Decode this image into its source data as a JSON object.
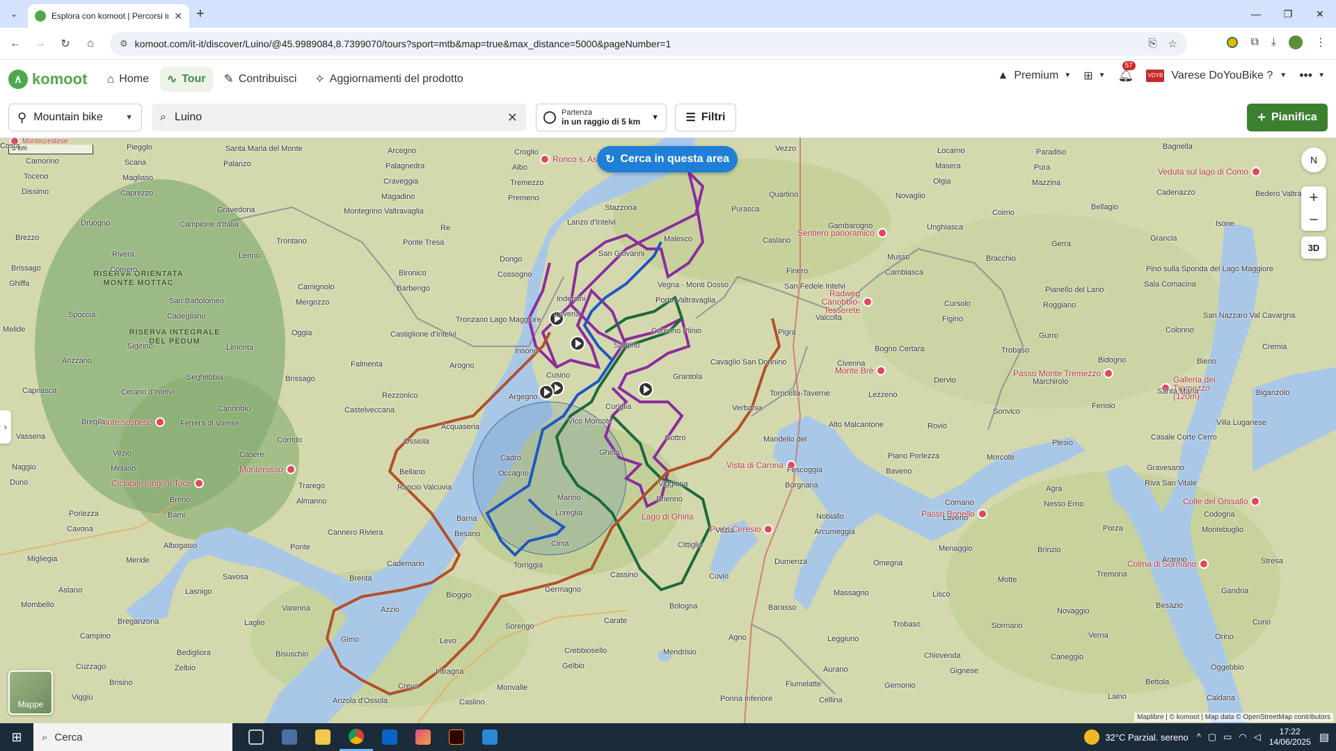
{
  "browser": {
    "tab_title": "Esplora con komoot | Percorsi in bici",
    "url": "komoot.com/it-it/discover/Luino/@45.9989084,8.7399070/tours?sport=mtb&map=true&max_distance=5000&pageNumber=1"
  },
  "header": {
    "logo": "komoot",
    "nav": [
      {
        "label": "Home",
        "icon": "home-icon"
      },
      {
        "label": "Tour",
        "icon": "tour-icon"
      },
      {
        "label": "Contribuisci",
        "icon": "contribute-icon"
      },
      {
        "label": "Aggiornamenti del prodotto",
        "icon": "updates-icon"
      }
    ],
    "premium": "Premium",
    "notifications_count": "57",
    "user_name": "Varese DoYouBike ?"
  },
  "filters": {
    "sport": "Mountain bike",
    "search_value": "Luino",
    "start_label": "Partenza",
    "start_value": "in un raggio di 5 km",
    "filters_label": "Filtri",
    "plan_label": "Pianifica"
  },
  "map": {
    "scale_label": "5 km",
    "search_area_label": "Cerca in questa area",
    "btn_3d": "3D",
    "compass_label": "N",
    "maps_label": "Mappe",
    "attribution": "Maplibre | © komoot | Map data © OpenStreetMap contributors",
    "regions": [
      {
        "text": "RISERVA ORIENTATA\nMONTE MOTTAC"
      },
      {
        "text": "RISERVA INTEGRALE\nDEL PEDUM"
      }
    ],
    "pois": [
      "Ronco s. Ascona",
      "Veduta sul lago di Como",
      "Sentiero panoramico",
      "Radweg Canobbio-Tesserete",
      "Monte Brè",
      "Passo Monte Tremezzo",
      "Galleria del Tremezzo (120m)",
      "Ponte sospeso",
      "Monterosso",
      "Ciclabile lungo il Toce",
      "Vista di Carona",
      "Lago di Ghirla",
      "Porto Ceresio",
      "Passo Bonello",
      "Colle del Ghisallo",
      "Colma di Sormano",
      "Montecrestese"
    ],
    "places": [
      "Costa",
      "Arcegno",
      "Locarno",
      "Camorino",
      "Palagnedra",
      "Masera",
      "Toceno",
      "Craveggia",
      "Olgia",
      "Dissimo",
      "Magadino",
      "Quartino",
      "Cadenazzo",
      "Gravedona",
      "Stazzona",
      "Coimo",
      "Druogno",
      "Re",
      "Gambarogno",
      "Isone",
      "Trontano",
      "Malesco",
      "Gerra",
      "Rivera",
      "Dongo",
      "Musso",
      "Brissago",
      "Bironico",
      "Finero",
      "Pino sulla Sponda del Lago Maggiore",
      "Camignolo",
      "Vegna - Monti Dosso",
      "Pianello del Lario",
      "San Bartolomeo",
      "Indemini",
      "Cursolo",
      "Spoccia",
      "Tronzano Lago Maggiore",
      "Valcolla",
      "San Nazzaro Val Cavargna",
      "Oggia",
      "Corenno Plinio",
      "Gurro",
      "Sigirino",
      "Insone",
      "Bogno Certara",
      "Cremia",
      "Falmenta",
      "Cavaglio San Donnino",
      "Bidogno",
      "Seghebbia",
      "Cusino",
      "Dervio",
      "Capriasca",
      "Rezzonico",
      "Torricella-Taverne",
      "Santa Maria",
      "Cannobio",
      "Curiglia",
      "Sonvico",
      "Bregila",
      "Acquaseria",
      "Alto Malcantone",
      "Villa Luganese",
      "Corrido",
      "Gottro",
      "Plesio",
      "Vezio",
      "Cadro",
      "Piano Porlezza",
      "Naggio",
      "Bellano",
      "Fescoggia",
      "Gravesano",
      "Trarego",
      "Viggiona",
      "Agra",
      "Breno",
      "Manno",
      "Comano",
      "Porlezza",
      "Barna",
      "Nobiallo",
      "Codogna",
      "Cannero Riviera",
      "Vezia",
      "Porza",
      "Albogasio",
      "Cima",
      "Menaggio",
      "Migliegia",
      "Cademario",
      "Dumenza",
      "Aranno",
      "Savosa",
      "Cassino",
      "Motte",
      "Astano",
      "Bioggio",
      "Massagno",
      "Gandria",
      "Varenna",
      "Bologna",
      "Novaggio",
      "Breganzona",
      "Sorengo",
      "Trobaso",
      "Curio",
      "Gimo",
      "Agno",
      "Verna",
      "Bedigliora",
      "Crebbiosello",
      "Chiovenda",
      "Cuzzago",
      "Intragna",
      "Aurano",
      "Oggebbio",
      "Creva",
      "Fiumelatte",
      "Bettola",
      "Anzola d'Ossola",
      "Ponna Inferiore",
      "Laino",
      "Piegglo",
      "Croglio",
      "Paradiso",
      "Scaria",
      "Albo",
      "Pura",
      "Magliaso",
      "Tremezzo",
      "Mazzina",
      "Caprezzo",
      "Premeno",
      "Novaglio",
      "Bedero Valtravaglia",
      "Montegrino Valtravaglia",
      "Purasca",
      "Bellagio",
      "Campione d'Italia",
      "Lanzo d'Intelvi",
      "Unghiasca",
      "Brezzo",
      "Ponte Tresa",
      "Caslano",
      "Grancia",
      "Lenno",
      "San Giovanni",
      "Bracchio",
      "Comero",
      "Cossogno",
      "Cambiasca",
      "Ghiffa",
      "Barbengo",
      "San Fedele Intelvi",
      "Sala Comacina",
      "Mergozzo",
      "Porto Valtravaglia",
      "Roggiano",
      "Cadegliano",
      "Lavena",
      "Figino",
      "Melide",
      "Castiglione d'Intelvi",
      "Pigra",
      "Colonno",
      "Limonta",
      "Santino",
      "Trobaso",
      "Arizzano",
      "Arogno",
      "Civenna",
      "Bieno",
      "Brissago",
      "Grantola",
      "Marchirolo",
      "Cerano d'Intelvi",
      "Argegno",
      "Lezzeno",
      "Biganzolo",
      "Castelveccana",
      "Verbania",
      "Feriolo",
      "Ferrera di Varese",
      "Vico Morcote",
      "Rovio",
      "Vassena",
      "Ossiola",
      "Mandello del",
      "Casale Corte Cerro",
      "Casere",
      "Ghirla",
      "Morcote",
      "Melano",
      "Occagno",
      "Baveno",
      "Duno",
      "Rancio Valcuvia",
      "Borgnana",
      "Riva San Vitale",
      "Almanno",
      "Brienno",
      "Nesso Erno",
      "Bami",
      "Loreglia",
      "Laveno",
      "Cavona",
      "Besano",
      "Arcumeggia",
      "Montebuglio",
      "Ponte",
      "Cittiglio",
      "Brinzio",
      "Meride",
      "Torriggia",
      "Omegna",
      "Stresa",
      "Brenta",
      "Cuvio",
      "Tremona",
      "Lasnigo",
      "Germagno",
      "Lisco",
      "Mombello",
      "Azzio",
      "Barasso",
      "Besazio",
      "Laglio",
      "Carate",
      "Sormano",
      "Campino",
      "Levo",
      "Leggiuno",
      "Orino",
      "Bisuschio",
      "Mendrisio",
      "Caneggio",
      "Zelbio",
      "Gelbio",
      "Gignese",
      "Brisino",
      "Monvalle",
      "Gemonio",
      "Viggiù",
      "Caslino",
      "Cellina",
      "Caldana",
      "Santa Maria del Monte",
      "Vezzo",
      "Bagnella",
      "Palanzo"
    ]
  },
  "taskbar": {
    "search_placeholder": "Cerca",
    "weather": "32°C  Parzial. sereno",
    "time": "17:22",
    "date": "14/06/2025"
  }
}
